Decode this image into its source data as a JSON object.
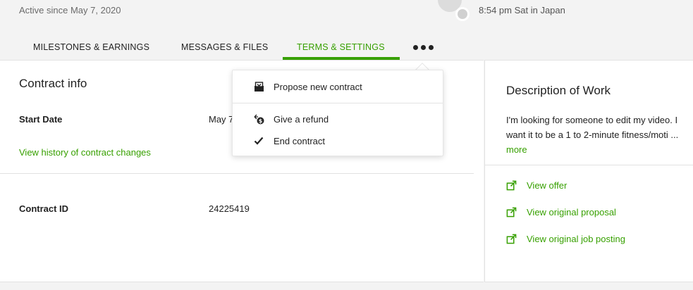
{
  "header": {
    "active_since": "Active since May 7, 2020",
    "local_time": "8:54 pm Sat in Japan"
  },
  "tabs": [
    {
      "label": "MILESTONES & EARNINGS",
      "active": false
    },
    {
      "label": "MESSAGES & FILES",
      "active": false
    },
    {
      "label": "TERMS & SETTINGS",
      "active": true
    }
  ],
  "contract_info": {
    "title": "Contract info",
    "start_date_label": "Start Date",
    "start_date_value": "May 7",
    "history_link": "View history of contract changes",
    "contract_id_label": "Contract ID",
    "contract_id_value": "24225419"
  },
  "dropdown": {
    "items": [
      {
        "label": "Propose new contract",
        "icon": "propose-contract-icon"
      },
      {
        "label": "Give a refund",
        "icon": "refund-icon"
      },
      {
        "label": "End contract",
        "icon": "checkmark-icon"
      }
    ]
  },
  "description": {
    "title": "Description of Work",
    "text": "I'm looking for someone to edit my video. I want it to be a 1 to 2-minute fitness/moti",
    "ellipsis": "...",
    "more_link": "more"
  },
  "side_links": [
    {
      "label": "View offer",
      "icon": "external-link-icon"
    },
    {
      "label": "View original proposal",
      "icon": "external-link-icon"
    },
    {
      "label": "View original job posting",
      "icon": "external-link-icon"
    }
  ],
  "colors": {
    "accent": "#37a000",
    "background": "#f3f3f3"
  }
}
